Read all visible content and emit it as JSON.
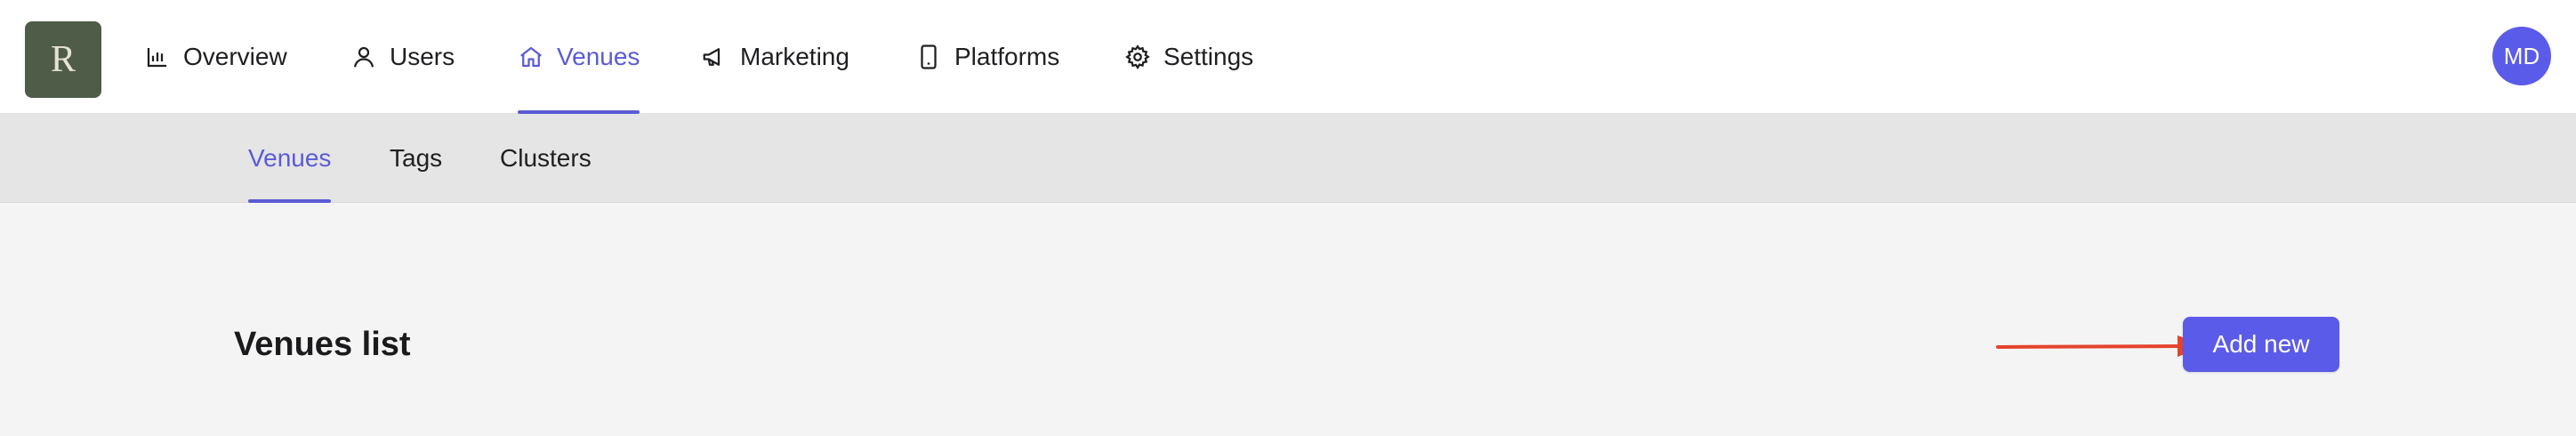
{
  "logo": {
    "letter": "R"
  },
  "nav": {
    "items": [
      {
        "label": "Overview",
        "icon": "chart-bar-icon"
      },
      {
        "label": "Users",
        "icon": "user-icon"
      },
      {
        "label": "Venues",
        "icon": "home-icon",
        "active": true
      },
      {
        "label": "Marketing",
        "icon": "megaphone-icon"
      },
      {
        "label": "Platforms",
        "icon": "mobile-phone-icon"
      },
      {
        "label": "Settings",
        "icon": "gear-icon"
      }
    ]
  },
  "avatar": {
    "initials": "MD"
  },
  "subnav": {
    "tabs": [
      {
        "label": "Venues",
        "active": true
      },
      {
        "label": "Tags"
      },
      {
        "label": "Clusters"
      }
    ]
  },
  "main": {
    "title": "Venues list",
    "add_button_label": "Add new"
  },
  "annotation": {
    "icon": "arrow-right-icon",
    "color": "#e5432d"
  },
  "colors": {
    "accent": "#5b5bd6",
    "button": "#5b5bea",
    "logo_bg": "#4f5c48"
  }
}
